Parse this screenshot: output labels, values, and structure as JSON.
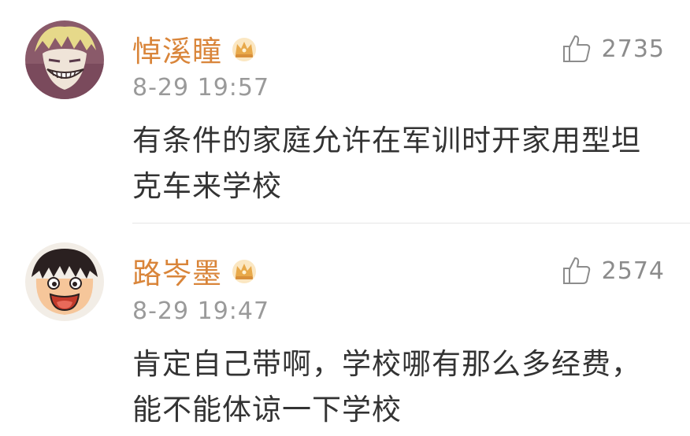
{
  "comments": [
    {
      "username": "悼溪瞳",
      "badge_icon": "crown-badge-icon",
      "timestamp": "8-29 19:57",
      "text": "有条件的家庭允许在军训时开家用型坦克车来学校",
      "likes": "2735",
      "like_icon": "thumbs-up-icon"
    },
    {
      "username": "路岑墨",
      "badge_icon": "crown-badge-icon",
      "timestamp": "8-29 19:47",
      "text": "肯定自己带啊，学校哪有那么多经费，能不能体谅一下学校",
      "likes": "2574",
      "like_icon": "thumbs-up-icon"
    }
  ],
  "colors": {
    "username": "#d9853a",
    "timestamp": "#9a9a9a",
    "text": "#333333",
    "likes": "#8c8c8c",
    "crown": "#e8a94a"
  }
}
